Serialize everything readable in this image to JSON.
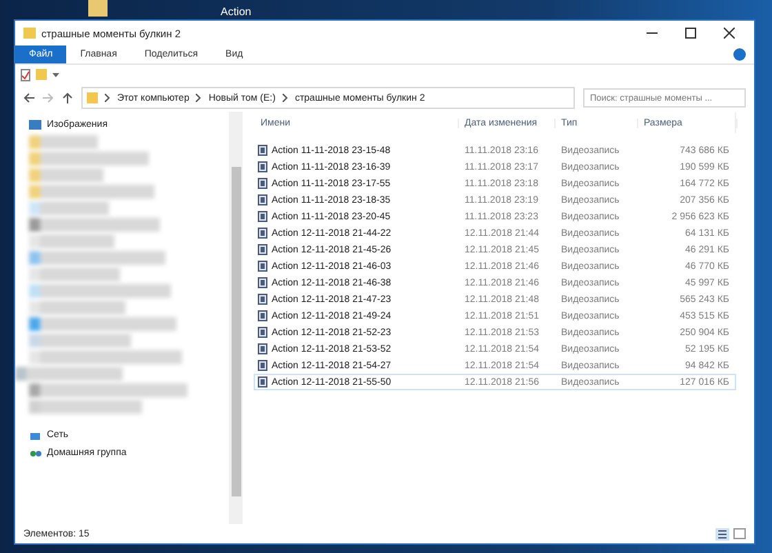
{
  "desktop": {
    "icon_label": "Action"
  },
  "window": {
    "title": "страшные моменты булкин 2"
  },
  "ribbon_tabs": [
    {
      "label": "Файл",
      "selected": true
    },
    {
      "label": "Главная",
      "selected": false
    },
    {
      "label": "Поделиться",
      "selected": false
    },
    {
      "label": "Вид",
      "selected": false
    }
  ],
  "address": {
    "crumbs": [
      "Этот компьютер",
      "Новый том (E:)",
      "страшные моменты булкин 2"
    ]
  },
  "search": {
    "placeholder": "Поиск: страшные моменты ..."
  },
  "sidebar": {
    "top_item": "Изображения",
    "items": [
      {
        "label": "Сеть",
        "kind": "network"
      },
      {
        "label": "Домашняя группа",
        "kind": "homegroup"
      }
    ]
  },
  "table": {
    "columns": [
      "Имени",
      "Дата изменения",
      "Тип",
      "Размера"
    ],
    "rows": [
      {
        "name": "Action 11-11-2018 23-15-48",
        "date": "11.11.2018 23:16",
        "type": "Видеозапись",
        "size": "743 686 КБ",
        "selected": false
      },
      {
        "name": "Action 11-11-2018 23-16-39",
        "date": "11.11.2018 23:17",
        "type": "Видеозапись",
        "size": "190 599 КБ",
        "selected": false
      },
      {
        "name": "Action 11-11-2018 23-17-55",
        "date": "11.11.2018 23:18",
        "type": "Видеозапись",
        "size": "164 772 КБ",
        "selected": false
      },
      {
        "name": "Action 11-11-2018 23-18-35",
        "date": "11.11.2018 23:19",
        "type": "Видеозапись",
        "size": "207 356 КБ",
        "selected": false
      },
      {
        "name": "Action 11-11-2018 23-20-45",
        "date": "11.11.2018 23:23",
        "type": "Видеозапись",
        "size": "2 956 623 КБ",
        "selected": false
      },
      {
        "name": "Action 12-11-2018 21-44-22",
        "date": "12.11.2018 21:44",
        "type": "Видеозапись",
        "size": "64 131 КБ",
        "selected": false
      },
      {
        "name": "Action 12-11-2018 21-45-26",
        "date": "12.11.2018 21:45",
        "type": "Видеозапись",
        "size": "46 291 КБ",
        "selected": false
      },
      {
        "name": "Action 12-11-2018 21-46-03",
        "date": "12.11.2018 21:46",
        "type": "Видеозапись",
        "size": "46 770 КБ",
        "selected": false
      },
      {
        "name": "Action 12-11-2018 21-46-38",
        "date": "12.11.2018 21:46",
        "type": "Видеозапись",
        "size": "45 997 КБ",
        "selected": false
      },
      {
        "name": "Action 12-11-2018 21-47-23",
        "date": "12.11.2018 21:48",
        "type": "Видеозапись",
        "size": "565 243 КБ",
        "selected": false
      },
      {
        "name": "Action 12-11-2018 21-49-24",
        "date": "12.11.2018 21:51",
        "type": "Видеозапись",
        "size": "453 515 КБ",
        "selected": false
      },
      {
        "name": "Action 12-11-2018 21-52-23",
        "date": "12.11.2018 21:53",
        "type": "Видеозапись",
        "size": "250 904 КБ",
        "selected": false
      },
      {
        "name": "Action 12-11-2018 21-53-52",
        "date": "12.11.2018 21:54",
        "type": "Видеозапись",
        "size": "52 195 КБ",
        "selected": false
      },
      {
        "name": "Action 12-11-2018 21-54-27",
        "date": "12.11.2018 21:54",
        "type": "Видеозапись",
        "size": "94 842 КБ",
        "selected": false
      },
      {
        "name": "Action 12-11-2018 21-55-50",
        "date": "12.11.2018 21:56",
        "type": "Видеозапись",
        "size": "127 016 КБ",
        "selected": true
      }
    ]
  },
  "status_bar": {
    "text": "Элементов: 15"
  }
}
